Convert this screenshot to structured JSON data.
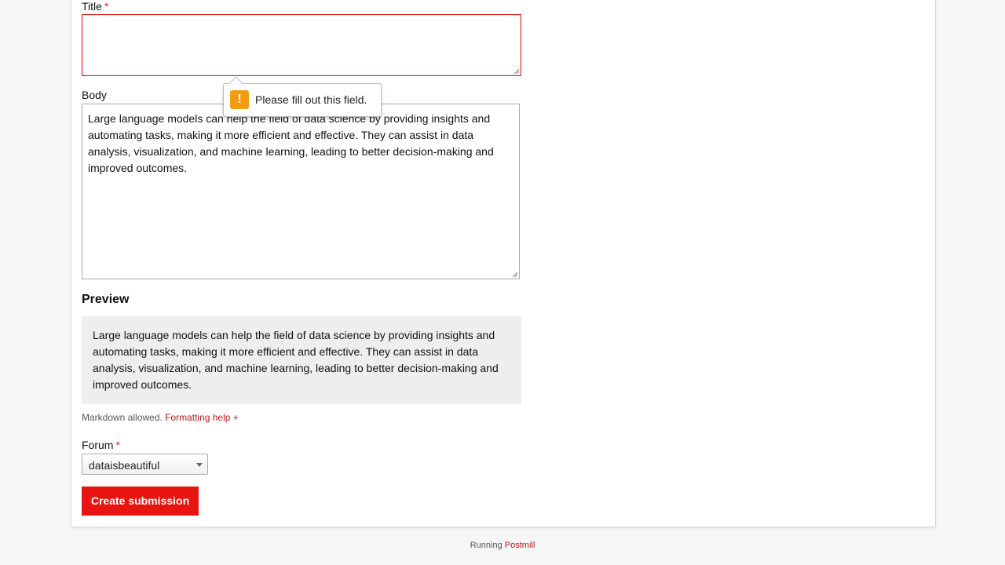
{
  "form": {
    "title_label": "Title",
    "title_required": "*",
    "title_value": "",
    "body_label": "Body",
    "body_value": "Large language models can help the field of data science by providing insights and automating tasks, making it more efficient and effective. They can assist in data analysis, visualization, and machine learning, leading to better decision-making and improved outcomes.",
    "validation_tooltip": "Please fill out this field.",
    "validation_icon": "warning-icon",
    "preview_heading": "Preview",
    "preview_text": "Large language models can help the field of data science by providing insights and automating tasks, making it more efficient and effective. They can assist in data analysis, visualization, and machine learning, leading to better decision-making and improved outcomes.",
    "markdown_note": "Markdown allowed.",
    "formatting_help_link": "Formatting help +",
    "forum_label": "Forum",
    "forum_required": "*",
    "forum_selected": "dataisbeautiful",
    "submit_label": "Create submission"
  },
  "footer": {
    "running_text": "Running",
    "app_link": "Postmill"
  },
  "colors": {
    "accent": "#e8140f",
    "link": "#c4131a",
    "error_border": "#d7261e",
    "warning": "#f39c12",
    "preview_bg": "#eeeeee"
  }
}
